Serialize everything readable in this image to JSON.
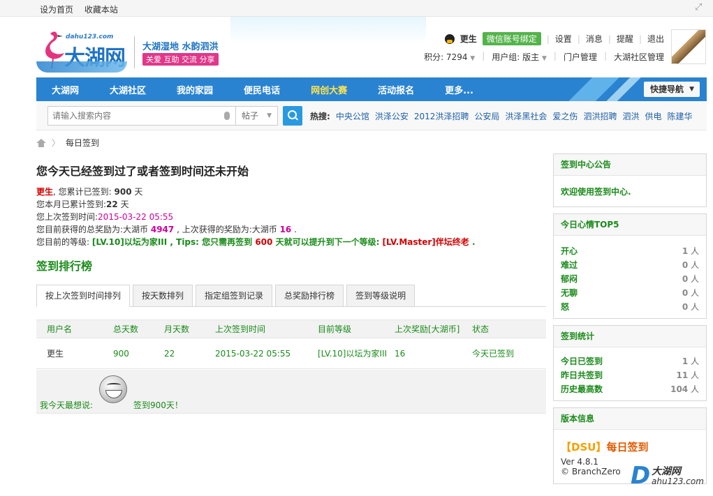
{
  "topbar": {
    "links": [
      "设为首页",
      "收藏本站"
    ]
  },
  "logo": {
    "domain": "dahu123.com",
    "name": "大湖网",
    "slogan_main": "大湖湿地 水韵泗洪",
    "slogan_tags": "关爱 互助 交流 分享"
  },
  "user": {
    "name": "更生",
    "wechat_bind": "微信账号绑定",
    "links": [
      "设置",
      "消息",
      "提醒",
      "退出"
    ],
    "points": "积分: 7294",
    "group": "用户组: 版主",
    "portal": "门户管理",
    "community": "大湖社区管理"
  },
  "nav": {
    "items": [
      "大湖网",
      "大湖社区",
      "我的家园",
      "便民电话",
      "网创大赛",
      "活动报名",
      "更多..."
    ],
    "quick": "快捷导航"
  },
  "search": {
    "placeholder": "请输入搜索内容",
    "type": "帖子",
    "hot_label": "热搜:",
    "hot": [
      "中央公馆",
      "洪泽公安",
      "2012洪泽招聘",
      "公安局",
      "洪泽黑社会",
      "爱之伤",
      "泗洪招聘",
      "泗洪",
      "供电",
      "陈建华"
    ]
  },
  "breadcrumb": {
    "current": "每日签到"
  },
  "main": {
    "title": "您今天已经签到过了或者签到时间还未开始",
    "s1_name": "更生",
    "s1_text": ", 您累计已签到: ",
    "s1_num": "900",
    "s1_unit": " 天",
    "s2_text": "您本月已累计签到:",
    "s2_num": "22",
    "s2_unit": " 天",
    "s3_text": "您上次签到时间:",
    "s3_val": "2015-03-22 05:55",
    "s4_text": "您目前获得的总奖励为:大湖币 ",
    "s4_total": "4947",
    "s4_mid": " , 上次获得的奖励为:大湖币 ",
    "s4_last": "16",
    "s4_end": " .",
    "s5_text": "您目前的等级: ",
    "s5_level": "[LV.10]以坛为家III",
    "s5_tips": " , Tips: 您只需再签到 ",
    "s5_days": "600",
    "s5_mid": " 天就可以提升到下一个等级: ",
    "s5_next": "[LV.Master]伴坛终老",
    "s5_end": " .",
    "rank_title": "签到排行榜"
  },
  "tabs": [
    "按上次签到时间排列",
    "按天数排列",
    "指定组签到记录",
    "总奖励排行榜",
    "签到等级说明"
  ],
  "table": {
    "headers": [
      "用户名",
      "总天数",
      "月天数",
      "上次签到时间",
      "目前等级",
      "上次奖励[大湖币]",
      "状态"
    ],
    "rows": [
      [
        "更生",
        "900",
        "22",
        "2015-03-22 05:55",
        "[LV.10]以坛为家III",
        "16",
        "今天已签到"
      ]
    ]
  },
  "thought": {
    "label": "我今天最想说:",
    "message": "签到900天！"
  },
  "sidebar": {
    "notice": {
      "title": "签到中心公告",
      "text": "欢迎使用签到中心."
    },
    "mood": {
      "title": "今日心情TOP5",
      "items": [
        {
          "k": "开心",
          "v": "1",
          "u": " 人"
        },
        {
          "k": "难过",
          "v": "0",
          "u": " 人"
        },
        {
          "k": "郁闷",
          "v": "0",
          "u": " 人"
        },
        {
          "k": "无聊",
          "v": "0",
          "u": " 人"
        },
        {
          "k": "怒",
          "v": "0",
          "u": " 人"
        }
      ]
    },
    "stats": {
      "title": "签到统计",
      "items": [
        {
          "k": "今日已签到",
          "v": "1",
          "u": " 人"
        },
        {
          "k": "昨日共签到",
          "v": "11",
          "u": " 人"
        },
        {
          "k": "历史最高数",
          "v": "104",
          "u": " 人"
        }
      ]
    },
    "version": {
      "title": "版本信息",
      "tag": "【DSU】",
      "name": "每日签到",
      "ver": "Ver 4.8.1",
      "copy": "© BranchZero"
    }
  },
  "watermark": {
    "letter": "D",
    "name": "大湖网",
    "url": "ahu123.com"
  }
}
